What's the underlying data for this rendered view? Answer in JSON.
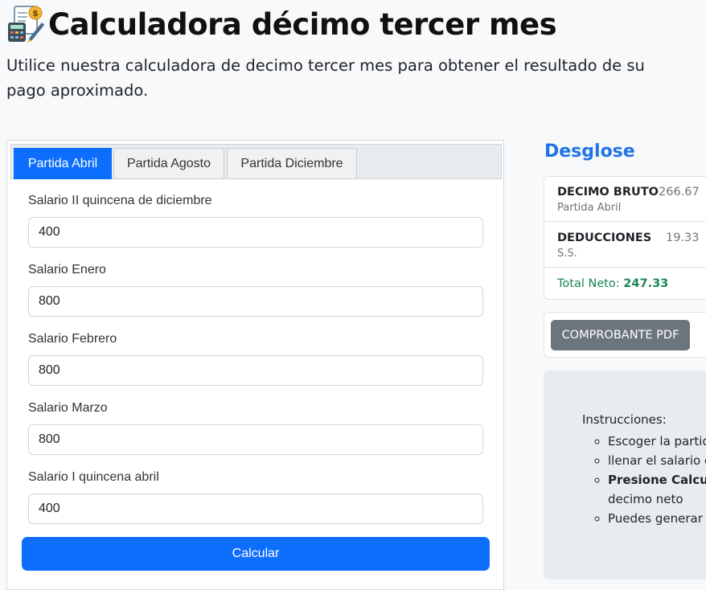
{
  "header": {
    "title": "Calculadora décimo tercer mes",
    "subtitle": "Utilice nuestra calculadora de decimo tercer mes para obtener el resultado de su pago aproximado."
  },
  "tabs": [
    {
      "label": "Partida Abril",
      "active": true
    },
    {
      "label": "Partida Agosto",
      "active": false
    },
    {
      "label": "Partida Diciembre",
      "active": false
    }
  ],
  "form": {
    "fields": [
      {
        "label": "Salario II quincena de diciembre",
        "value": "400"
      },
      {
        "label": "Salario Enero",
        "value": "800"
      },
      {
        "label": "Salario Febrero",
        "value": "800"
      },
      {
        "label": "Salario Marzo",
        "value": "800"
      },
      {
        "label": "Salario I quincena abril",
        "value": "400"
      }
    ],
    "submit_label": "Calcular"
  },
  "desglose": {
    "title": "Desglose",
    "items": [
      {
        "name": "DECIMO BRUTO",
        "sub": "Partida Abril",
        "value": "266.67"
      },
      {
        "name": "DEDUCCIONES",
        "sub": "S.S.",
        "value": "19.33"
      }
    ],
    "total_label": "Total Neto:",
    "total_value": "247.33"
  },
  "pdf_button_label": "COMPROBANTE PDF",
  "instructions": {
    "title": "Instrucciones:",
    "items": [
      "Escoger la partida",
      "llenar el salario co",
      "Presione Calcula",
      "decimo neto",
      "Puedes generar u"
    ]
  },
  "colors": {
    "primary": "#0d6efd",
    "heading_blue": "#1e73e8",
    "success": "#198754",
    "secondary": "#6c757d"
  }
}
